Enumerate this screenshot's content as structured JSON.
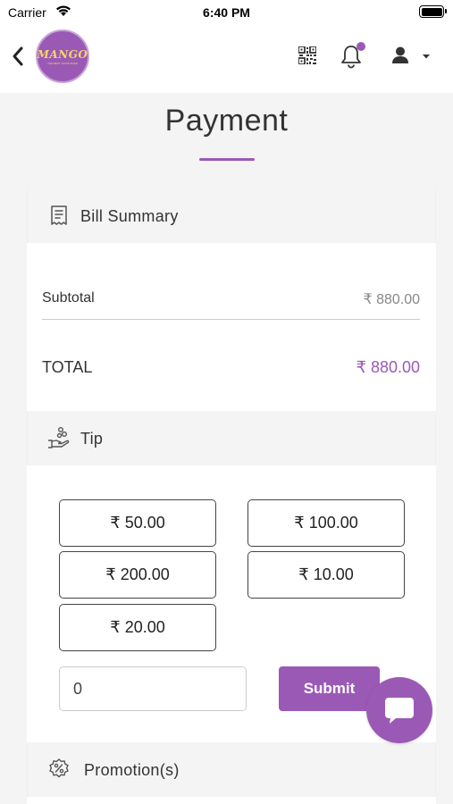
{
  "status_bar": {
    "carrier": "Carrier",
    "time": "6:40 PM"
  },
  "header": {
    "logo_text": "MANGO",
    "logo_subtext": "THE BEST TASTE EVER",
    "icons": [
      "back-chevron-icon",
      "qr-code-icon",
      "bell-icon",
      "user-icon",
      "caret-down-icon"
    ],
    "notification_dot": true
  },
  "page": {
    "title": "Payment"
  },
  "bill_summary": {
    "heading": "Bill Summary",
    "subtotal_label": "Subtotal",
    "subtotal_value": "₹ 880.00",
    "total_label": "TOTAL",
    "total_value": "₹ 880.00"
  },
  "tip": {
    "heading": "Tip",
    "options": [
      "₹ 50.00",
      "₹ 100.00",
      "₹ 200.00",
      "₹ 10.00",
      "₹ 20.00"
    ],
    "input_value": "0",
    "submit_label": "Submit"
  },
  "promotions": {
    "heading": "Promotion(s)"
  },
  "colors": {
    "accent": "#9b59b6",
    "background": "#f4f4f4",
    "card": "#ffffff",
    "text": "#333333"
  }
}
